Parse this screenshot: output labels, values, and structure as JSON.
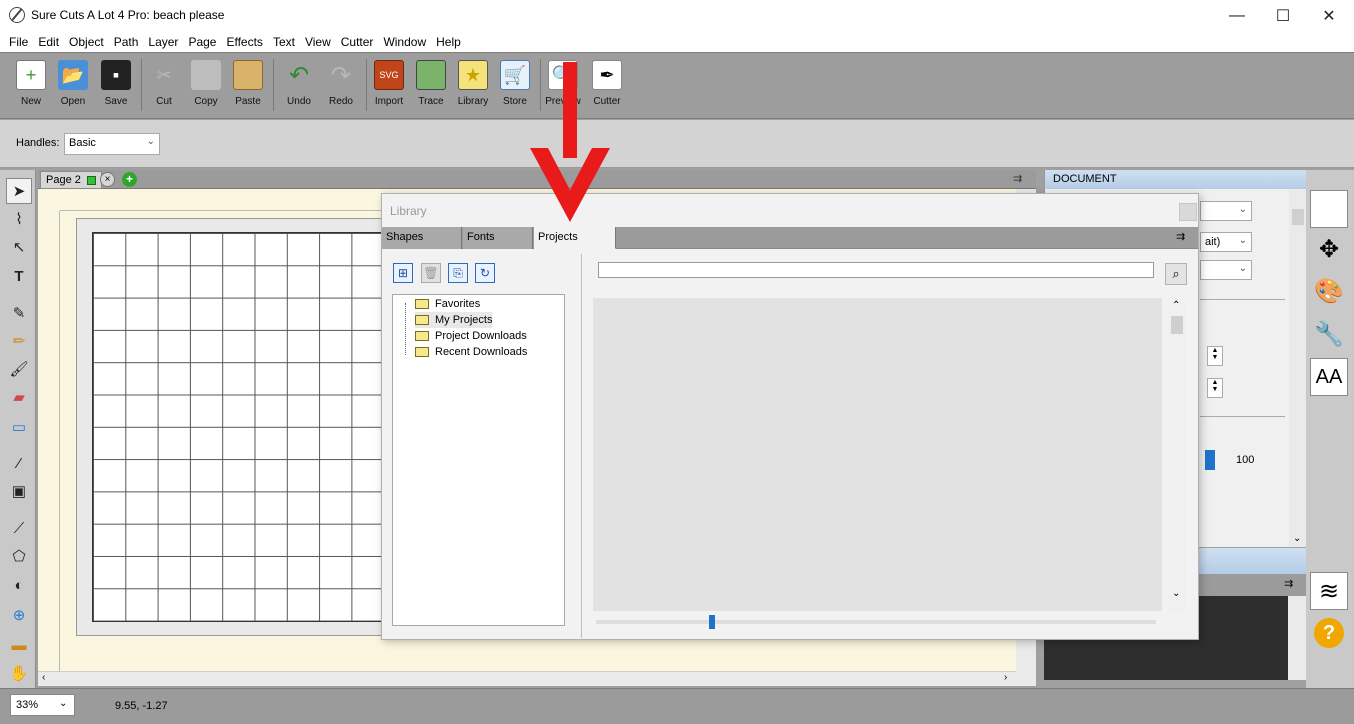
{
  "window": {
    "title": "Sure Cuts A Lot 4 Pro: beach please"
  },
  "menu": [
    "File",
    "Edit",
    "Object",
    "Path",
    "Layer",
    "Page",
    "Effects",
    "Text",
    "View",
    "Cutter",
    "Window",
    "Help"
  ],
  "toolbar": {
    "new": "New",
    "open": "Open",
    "save": "Save",
    "cut": "Cut",
    "copy": "Copy",
    "paste": "Paste",
    "undo": "Undo",
    "redo": "Redo",
    "import": "Import",
    "trace": "Trace",
    "library": "Library",
    "store": "Store",
    "preview": "Preview",
    "cutter": "Cutter"
  },
  "handles": {
    "label": "Handles:",
    "value": "Basic"
  },
  "page_tab": {
    "label": "Page 2"
  },
  "document_panel": {
    "header": "DOCUMENT",
    "partial_value": "ait)",
    "value_100": "100"
  },
  "library": {
    "title": "Library",
    "tabs": [
      "Shapes",
      "Fonts",
      "Projects"
    ],
    "tree": [
      "Favorites",
      "My Projects",
      "Project Downloads",
      "Recent Downloads"
    ],
    "search_value": ""
  },
  "status": {
    "zoom": "33%",
    "coords": "9.55, -1.27"
  },
  "colors": {
    "accent_red": "#e81a1a",
    "slider_blue": "#1f73c8",
    "panel_header": "#c3d6ec"
  }
}
